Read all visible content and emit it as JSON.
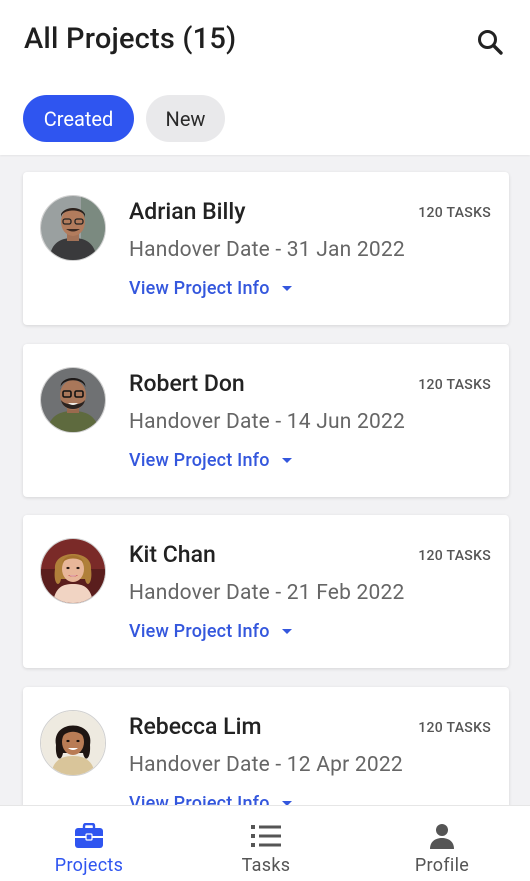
{
  "header": {
    "title": "All Projects (15)",
    "search_icon": "search-icon"
  },
  "filters": [
    {
      "label": "Created",
      "selected": true
    },
    {
      "label": "New",
      "selected": false
    }
  ],
  "projects": [
    {
      "name": "Adrian Billy",
      "tasks": "120 TASKS",
      "handover": "Handover Date - 31 Jan 2022",
      "link": "View Project Info"
    },
    {
      "name": "Robert Don",
      "tasks": "120 TASKS",
      "handover": "Handover Date - 14 Jun 2022",
      "link": "View Project Info"
    },
    {
      "name": "Kit Chan",
      "tasks": "120 TASKS",
      "handover": "Handover Date - 21 Feb 2022",
      "link": "View Project Info"
    },
    {
      "name": "Rebecca Lim",
      "tasks": "120 TASKS",
      "handover": "Handover Date - 12 Apr 2022",
      "link": "View Project Info"
    }
  ],
  "bottom_nav": [
    {
      "label": "Projects",
      "icon": "briefcase-icon",
      "active": true
    },
    {
      "label": "Tasks",
      "icon": "list-icon",
      "active": false
    },
    {
      "label": "Profile",
      "icon": "person-icon",
      "active": false
    }
  ],
  "colors": {
    "accent": "#2f55f0",
    "link": "#3457dd",
    "background": "#f2f2f4",
    "chip_inactive": "#e9e9eb"
  }
}
